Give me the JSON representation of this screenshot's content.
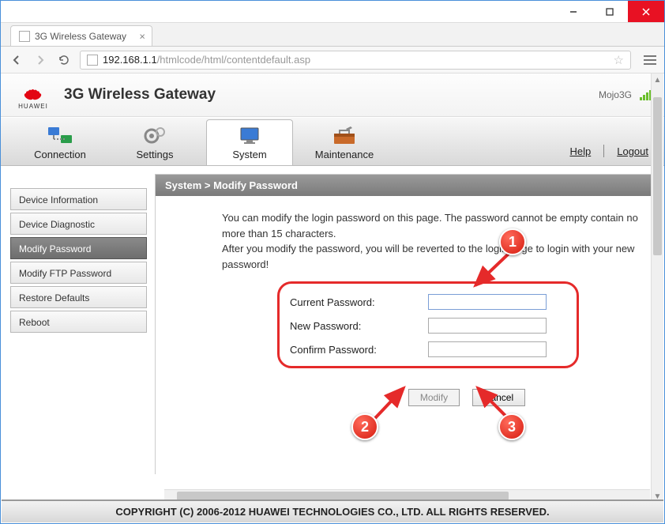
{
  "window": {
    "tab_title": "3G Wireless Gateway",
    "url_host": "192.168.1.1",
    "url_path": "/htmlcode/html/contentdefault.asp"
  },
  "header": {
    "brand": "HUAWEI",
    "title": "3G Wireless Gateway",
    "network_name": "Mojo3G"
  },
  "nav": {
    "items": [
      {
        "label": "Connection"
      },
      {
        "label": "Settings"
      },
      {
        "label": "System"
      },
      {
        "label": "Maintenance"
      }
    ],
    "help": "Help",
    "logout": "Logout"
  },
  "sidebar": {
    "items": [
      {
        "label": "Device Information"
      },
      {
        "label": "Device Diagnostic"
      },
      {
        "label": "Modify Password"
      },
      {
        "label": "Modify FTP Password"
      },
      {
        "label": "Restore Defaults"
      },
      {
        "label": "Reboot"
      }
    ]
  },
  "main": {
    "breadcrumb": "System > Modify Password",
    "desc_line1": "You can modify the login password on this page. The password cannot be empty contain no more than 15 characters.",
    "desc_line2": "After you modify the password, you will be reverted to the login page to login with your new password!",
    "labels": {
      "current": "Current Password:",
      "new": "New Password:",
      "confirm": "Confirm Password:"
    },
    "values": {
      "current": "",
      "new": "",
      "confirm": ""
    },
    "buttons": {
      "modify": "Modify",
      "cancel": "Cancel"
    }
  },
  "annotations": {
    "a1": "1",
    "a2": "2",
    "a3": "3"
  },
  "footer": "COPYRIGHT (C) 2006-2012 HUAWEI TECHNOLOGIES CO., LTD. ALL RIGHTS RESERVED."
}
